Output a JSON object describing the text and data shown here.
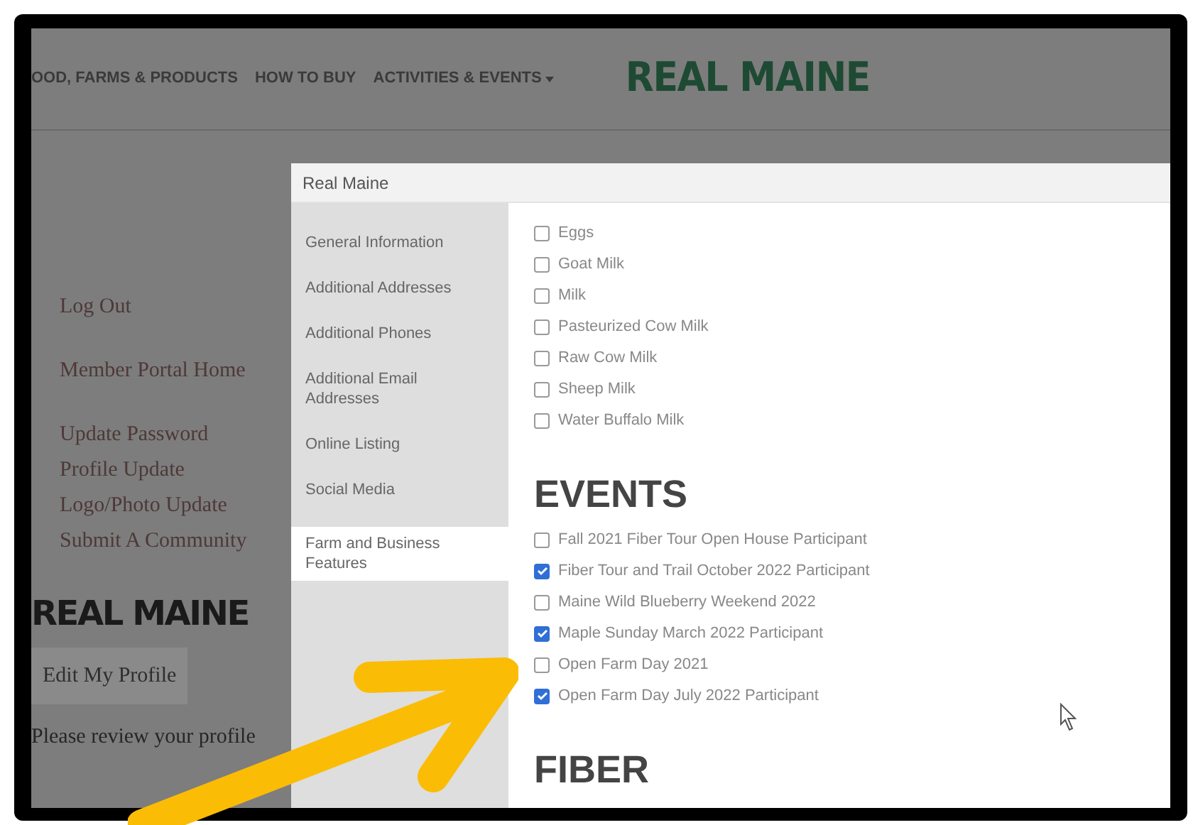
{
  "nav": {
    "items": [
      "OOD, FARMS & PRODUCTS",
      "HOW TO BUY",
      "ACTIVITIES & EVENTS"
    ],
    "logo": "REAL MAINE"
  },
  "left": {
    "link_groups": [
      [
        "Log Out"
      ],
      [
        "Member Portal Home"
      ],
      [
        "Update Password",
        "Profile Update",
        "Logo/Photo Update",
        "Submit A Community"
      ]
    ],
    "brand": "REAL MAINE",
    "button": "Edit My Profile",
    "note": "Please review your profile"
  },
  "modal": {
    "title": "Real Maine",
    "tabs": [
      {
        "label": "General Information",
        "selected": false
      },
      {
        "label": "Additional Addresses",
        "selected": false
      },
      {
        "label": "Additional Phones",
        "selected": false
      },
      {
        "label": "Additional Email Addresses",
        "selected": false
      },
      {
        "label": "Online Listing",
        "selected": false
      },
      {
        "label": "Social Media",
        "selected": false
      },
      {
        "label": "Farm and Business Features",
        "selected": true
      }
    ],
    "sections": [
      {
        "items": [
          {
            "label": "Eggs",
            "checked": false
          },
          {
            "label": "Goat Milk",
            "checked": false
          },
          {
            "label": "Milk",
            "checked": false
          },
          {
            "label": "Pasteurized Cow Milk",
            "checked": false
          },
          {
            "label": "Raw Cow Milk",
            "checked": false
          },
          {
            "label": "Sheep Milk",
            "checked": false
          },
          {
            "label": "Water Buffalo Milk",
            "checked": false
          }
        ]
      },
      {
        "heading": "EVENTS",
        "items": [
          {
            "label": "Fall 2021 Fiber Tour Open House Participant",
            "checked": false
          },
          {
            "label": "Fiber Tour and Trail October 2022 Participant",
            "checked": true
          },
          {
            "label": "Maine Wild Blueberry Weekend 2022",
            "checked": false
          },
          {
            "label": "Maple Sunday March 2022 Participant",
            "checked": true
          },
          {
            "label": "Open Farm Day 2021",
            "checked": false
          },
          {
            "label": "Open Farm Day July 2022 Participant",
            "checked": true
          }
        ]
      },
      {
        "heading": "FIBER"
      }
    ]
  }
}
